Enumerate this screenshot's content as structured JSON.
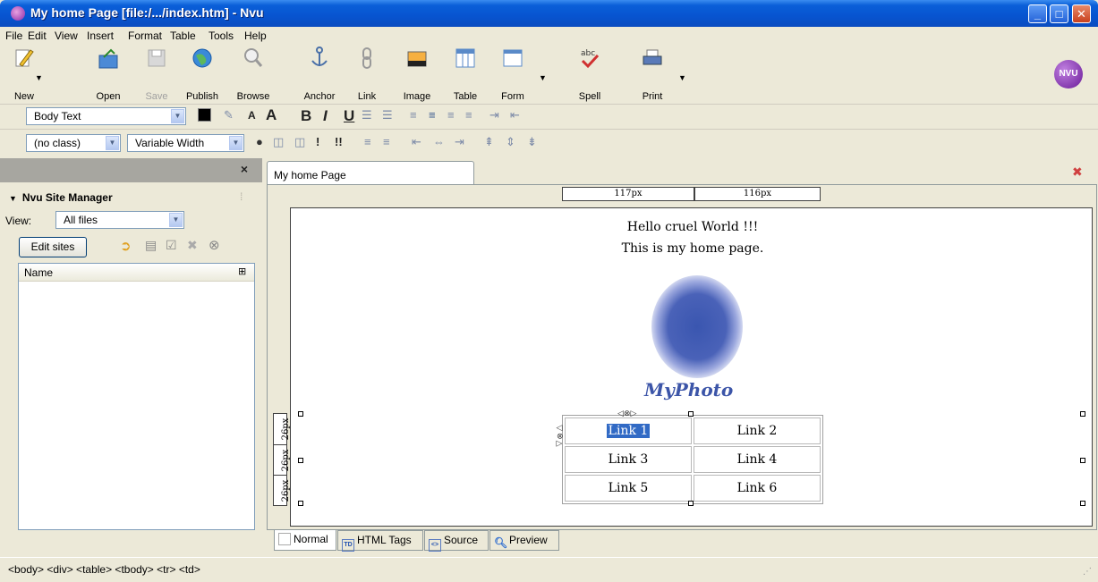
{
  "window": {
    "title": "My home Page [file:/.../index.htm] - Nvu",
    "min": "_",
    "max": "□",
    "close": "✕"
  },
  "menu": [
    "File",
    "Edit",
    "View",
    "Insert",
    "Format",
    "Table",
    "Tools",
    "Help"
  ],
  "toolbar": {
    "new": "New",
    "open": "Open",
    "save": "Save",
    "publish": "Publish",
    "browse": "Browse",
    "anchor": "Anchor",
    "link": "Link",
    "image": "Image",
    "table": "Table",
    "form": "Form",
    "spell": "Spell",
    "print": "Print",
    "logo": "NVU"
  },
  "format1": {
    "paragraph_style": "Body Text",
    "bold": "B",
    "italic": "I",
    "underline": "U",
    "smaller": "A",
    "larger": "A"
  },
  "format2": {
    "class_select": "(no class)",
    "font_select": "Variable Width",
    "important1": "!",
    "important2": "!!"
  },
  "site_manager": {
    "title": "Nvu Site Manager",
    "view_label": "View:",
    "view_value": "All files",
    "edit_sites": "Edit sites",
    "column_name": "Name",
    "close": "×"
  },
  "editor": {
    "tab_title": "My home Page",
    "ruler_col1": "117px",
    "ruler_col2": "116px",
    "ruler_row": "26px",
    "line1": "Hello cruel World !!!",
    "line2": "This is my home page.",
    "photo_caption": "MyPhoto",
    "links": [
      [
        "Link 1",
        "Link 2"
      ],
      [
        "Link 3",
        "Link 4"
      ],
      [
        "Link 5",
        "Link 6"
      ]
    ]
  },
  "mode_tabs": {
    "normal": "Normal",
    "html_tags": "HTML Tags",
    "source": "Source",
    "preview": "Preview",
    "td_icon": "TD",
    "source_icon": "<>"
  },
  "status_bar": "<body> <div> <table> <tbody> <tr> <td>"
}
